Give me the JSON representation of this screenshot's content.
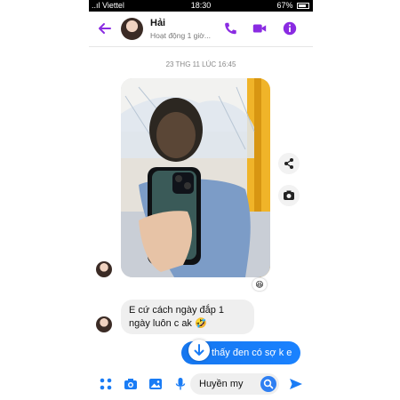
{
  "status_bar": {
    "carrier": "Viettel",
    "time": "18:30",
    "battery": "67%"
  },
  "header": {
    "name": "Hải",
    "status": "Hoạt động 1 giờ..."
  },
  "conversation": {
    "timestamp": "23 THG 11 LÚC 16:45",
    "photo_reaction": "😆",
    "received_message": "E cứ cách ngày đắp 1 ngày luôn c ak 🤣",
    "sent_message": "thấy đen có sợ k e"
  },
  "composer": {
    "input_value": "Huyền my"
  },
  "colors": {
    "accent": "#8a2be2",
    "bubble_out": "#1a7cf5",
    "bubble_in": "#efefef"
  }
}
